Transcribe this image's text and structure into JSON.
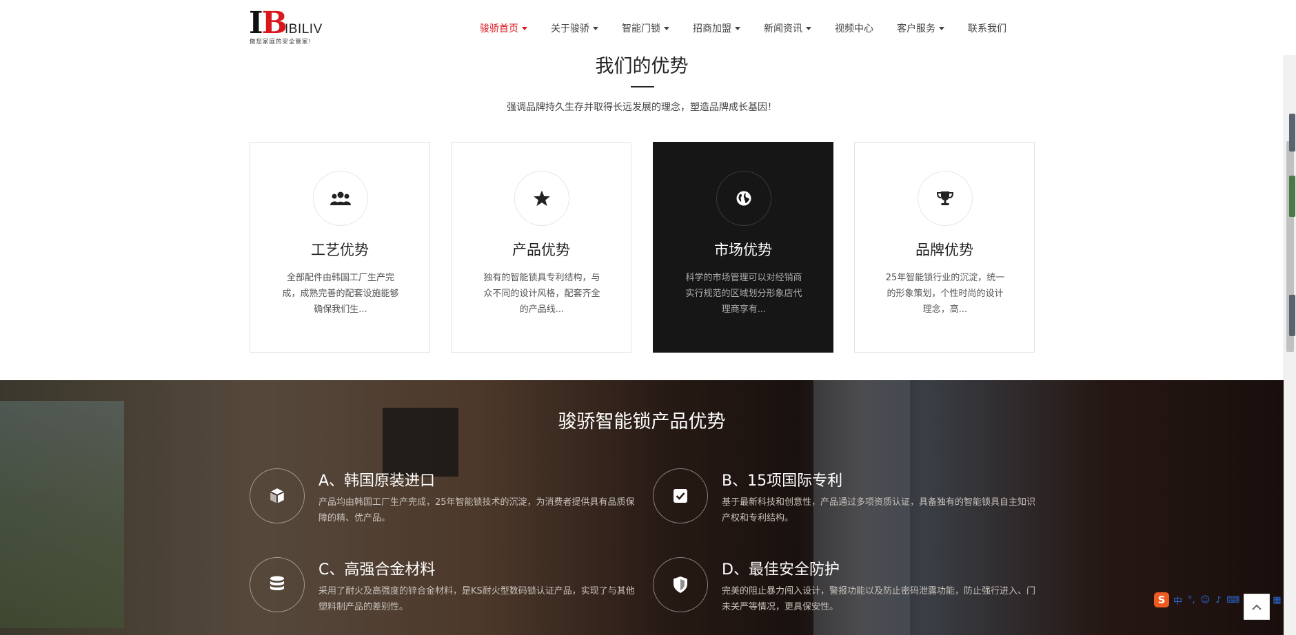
{
  "header": {
    "logo_letters": [
      "I",
      "B"
    ],
    "logo_text": "IBILIV",
    "logo_tagline": "做您家庭的安全管家!",
    "nav": [
      {
        "label": "骏骄首页",
        "active": true,
        "has_dropdown": true
      },
      {
        "label": "关于骏骄",
        "active": false,
        "has_dropdown": true
      },
      {
        "label": "智能门锁",
        "active": false,
        "has_dropdown": true
      },
      {
        "label": "招商加盟",
        "active": false,
        "has_dropdown": true
      },
      {
        "label": "新闻资讯",
        "active": false,
        "has_dropdown": true
      },
      {
        "label": "视频中心",
        "active": false,
        "has_dropdown": false
      },
      {
        "label": "客户服务",
        "active": false,
        "has_dropdown": true
      },
      {
        "label": "联系我们",
        "active": false,
        "has_dropdown": false
      }
    ]
  },
  "advantages": {
    "title": "我们的优势",
    "subtitle": "强调品牌持久生存并取得长远发展的理念，塑造品牌成长基因！",
    "cards": [
      {
        "icon": "users-icon",
        "title": "工艺优势",
        "desc": "全部配件由韩国工厂生产完成，成熟完善的配套设施能够确保我们生...",
        "dark": false
      },
      {
        "icon": "star-icon",
        "title": "产品优势",
        "desc": "独有的智能锁具专利结构，与众不同的设计风格，配套齐全的产品线...",
        "dark": false
      },
      {
        "icon": "globe-icon",
        "title": "市场优势",
        "desc": "科学的市场管理可以对经销商实行规范的区域划分形象店代理商享有...",
        "dark": true
      },
      {
        "icon": "trophy-icon",
        "title": "品牌优势",
        "desc": "25年智能锁行业的沉淀，统一的形象策划，个性时尚的设计理念，高...",
        "dark": false
      }
    ]
  },
  "product": {
    "title": "骏骄智能锁产品优势",
    "features": [
      {
        "icon": "cube-icon",
        "title": "A、韩国原装进口",
        "desc": "产品均由韩国工厂生产完成，25年智能锁技术的沉淀，为消费者提供具有品质保障的精、优产品。"
      },
      {
        "icon": "checkbox-icon",
        "title": "B、15项国际专利",
        "desc": "基于最新科技和创意性，产品通过多项资质认证，具备独有的智能锁具自主知识产权和专利结构。"
      },
      {
        "icon": "database-icon",
        "title": "C、高强合金材料",
        "desc": "采用了耐火及高强度的锌合金材料，是KS耐火型数码锁认证产品，实现了与其他塑料制产品的差别性。"
      },
      {
        "icon": "shield-icon",
        "title": "D、最佳安全防护",
        "desc": "完美的阻止暴力闯入设计，警报功能以及防止密码泄露功能，防止强行进入、门未关严等情况，更具保安性。"
      }
    ]
  },
  "ime": {
    "logo": "S",
    "items": [
      "中",
      "°,"
    ]
  },
  "colors": {
    "accent_red": "#d9181e",
    "dark_card": "#161616",
    "ime_orange": "#ee5a1f"
  }
}
